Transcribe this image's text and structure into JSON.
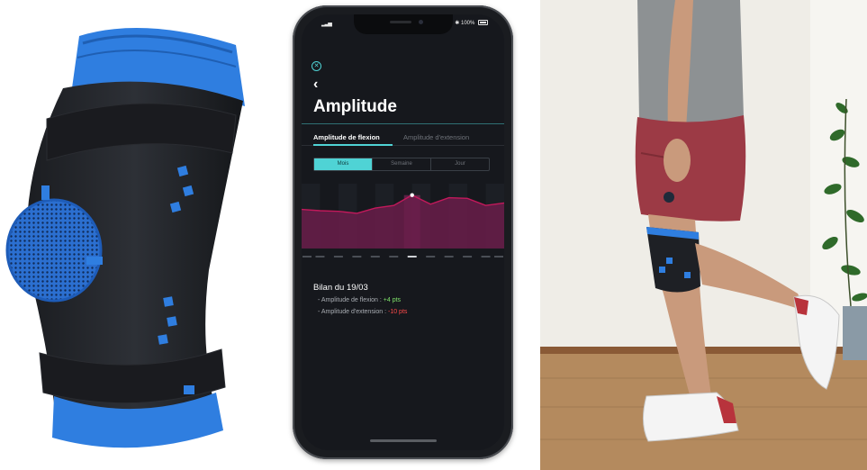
{
  "phone": {
    "status_right": "✱ 100%",
    "screen_title": "Amplitude",
    "tabs": [
      {
        "label": "Amplitude de flexion",
        "active": true
      },
      {
        "label": "Amplitude d'extension",
        "active": false
      }
    ],
    "segmented": [
      "Mois",
      "Semaine",
      "Jour"
    ],
    "summary": {
      "title": "Bilan du 19/03",
      "flexion_label": "- Amplitude de flexion : ",
      "flexion_value": "+4 pts",
      "extension_label": "- Amplitude d'extension : ",
      "extension_value": "-10 pts"
    }
  },
  "colors": {
    "accent": "#4fd3d5",
    "chart_line": "#c2195b",
    "chart_fill": "#6a1d4a",
    "positive": "#7fe36a",
    "negative": "#ff4a4a",
    "brace_blue": "#2f7ee0"
  },
  "chart_data": {
    "type": "area",
    "x": [
      0,
      1,
      2,
      3,
      4,
      5,
      6,
      7,
      8,
      9,
      10,
      11
    ],
    "values": [
      52,
      50,
      49,
      46,
      54,
      58,
      74,
      60,
      70,
      69,
      58,
      62
    ],
    "ylim": [
      0,
      100
    ],
    "highlight_index": 6,
    "grid": false
  }
}
